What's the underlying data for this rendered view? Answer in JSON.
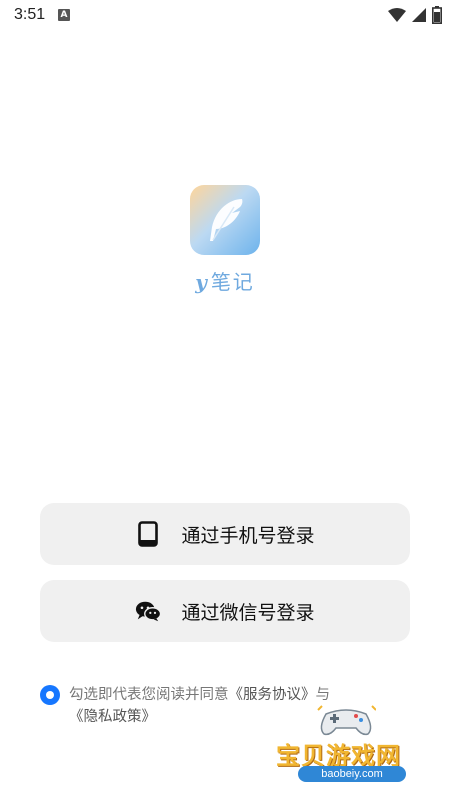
{
  "status_bar": {
    "time": "3:51",
    "notification_icon": "a-notification-icon",
    "wifi_icon": "wifi-icon",
    "signal_icon": "signal-icon",
    "battery_icon": "battery-icon"
  },
  "app": {
    "logo_icon": "feather-logo-icon",
    "name_prefix": "y",
    "name": "笔记"
  },
  "login": {
    "phone_label": "通过手机号登录",
    "phone_icon": "phone-icon",
    "wechat_label": "通过微信号登录",
    "wechat_icon": "wechat-icon"
  },
  "agreement": {
    "text": "勾选即代表您阅读并同意",
    "service_link": "《服务协议》",
    "conjunction": "与",
    "privacy_link": "《隐私政策》",
    "checked": true
  },
  "watermark": {
    "title": "宝贝游戏网",
    "url": "baobeiy.com"
  },
  "colors": {
    "accent": "#1677ff",
    "button_bg": "#f0f0f0",
    "app_name": "#6fa9df"
  }
}
